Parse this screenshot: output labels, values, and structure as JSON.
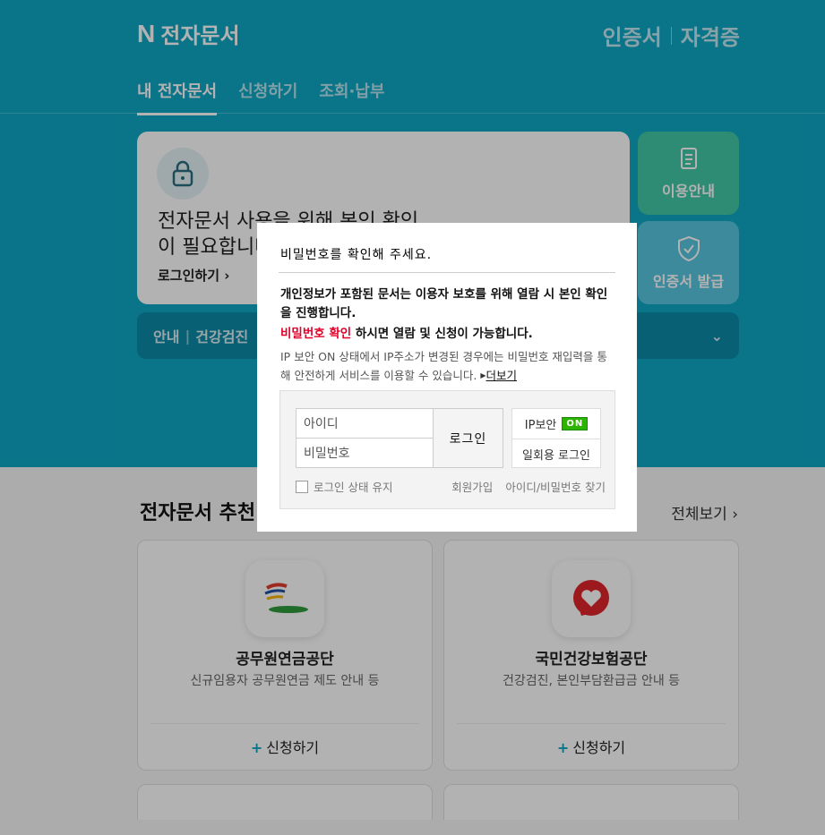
{
  "header": {
    "logo_mark": "N",
    "brand": "전자문서",
    "right_links": [
      "인증서",
      "자격증"
    ]
  },
  "tabs": [
    "내 전자문서",
    "신청하기",
    "조회·납부"
  ],
  "card": {
    "title": "전자문서 사용을 위해 본인 확인이 필요합니다",
    "login_link": "로그인하기 ›"
  },
  "side_buttons": {
    "guide": "이용안내",
    "cert": "인증서 발급"
  },
  "notice": {
    "label": "안내",
    "text": "건강검진"
  },
  "recommend": {
    "title": "전자문서 추천",
    "see_all": "전체보기 ›",
    "cards": [
      {
        "name": "공무원연금공단",
        "desc": "신규임용자 공무원연금 제도 안내 등",
        "apply": "신청하기"
      },
      {
        "name": "국민건강보험공단",
        "desc": "건강검진, 본인부담환급금 안내 등",
        "apply": "신청하기"
      }
    ]
  },
  "modal": {
    "title": "비밀번호를 확인해 주세요.",
    "message1": "개인정보가 포함된 문서는 이용자 보호를 위해 열람 시 본인 확인을 진행합니다.",
    "message2_red": "비밀번호 확인",
    "message2_rest": " 하시면 열람 및 신청이 가능합니다.",
    "message3": "IP 보안 ON 상태에서 IP주소가 변경된 경우에는 비밀번호 재입력을 통해 안전하게 서비스를 이용할 수 있습니다.",
    "more": "더보기",
    "id_placeholder": "아이디",
    "pw_placeholder": "비밀번호",
    "login_button": "로그인",
    "ip_security": "IP보안",
    "ip_badge": "ON",
    "otp_login": "일회용 로그인",
    "keep_login": "로그인 상태 유지",
    "join": "회원가입",
    "find": "아이디/비밀번호 찾기"
  }
}
